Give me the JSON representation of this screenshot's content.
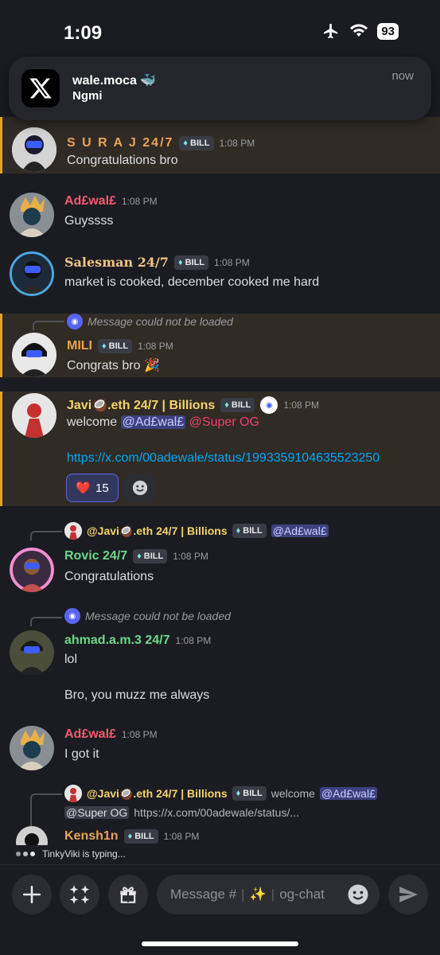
{
  "status": {
    "time": "1:09",
    "battery": "93"
  },
  "notification": {
    "title": "wale.moca 🐳",
    "body": "Ngmi",
    "time": "now"
  },
  "badge_label": "BILL",
  "messages": {
    "m1": {
      "name": "S U R A J  24/7",
      "time": "1:08 PM",
      "text": "Congratulations bro",
      "name_color": "#e8a35a"
    },
    "m2": {
      "name": "Ad£wal£",
      "time": "1:08 PM",
      "text": "Guyssss",
      "name_color": "#f25a6f"
    },
    "m3": {
      "name": "Salesman 24/7",
      "time": "1:08 PM",
      "text": "market is cooked, december cooked me hard",
      "name_color": "#f0c585"
    },
    "m4": {
      "reply": "Message could not be loaded",
      "name": "MILI",
      "time": "1:08 PM",
      "text": "Congrats bro 🎉",
      "name_color": "#f0a24a"
    },
    "m5": {
      "name": "Javi🥥.eth 24/7 | Billions",
      "time": "1:08 PM",
      "text_prefix": "welcome ",
      "mention1": "@Ad£wal£",
      "mention2": "@Super OG",
      "link": "https://x.com/00adewale/status/1993359104635523250",
      "reaction_emoji": "❤️",
      "reaction_count": "15",
      "name_color": "#f5d36c"
    },
    "m6": {
      "reply_name": "@Javi🥥.eth 24/7 | Billions",
      "reply_mention": "@Ad£wal£",
      "name": "Rovic 24/7",
      "time": "1:08 PM",
      "text": "Congratulations",
      "name_color": "#6bd88a"
    },
    "m7": {
      "reply": "Message could not be loaded",
      "name": "ahmad.a.m.3 24/7",
      "time": "1:08 PM",
      "text1": "lol",
      "text2": "Bro, you muzz me always",
      "name_color": "#6bd88a"
    },
    "m8": {
      "name": "Ad£wal£",
      "time": "1:08 PM",
      "text": "I got it",
      "name_color": "#f25a6f"
    },
    "m9": {
      "reply_name": "@Javi🥥.eth 24/7 | Billions",
      "reply_text": "welcome",
      "reply_mention1": "@Ad£wal£",
      "reply_mention2": "@Super OG",
      "reply_link": "https://x.com/00adewale/status/...",
      "name": "Kensh1n",
      "time": "1:08 PM",
      "name_color": "#e8a35a"
    }
  },
  "typing": "TinkyViki is typing...",
  "composer": {
    "placeholder_prefix": "Message #",
    "sparkle": "✨",
    "channel": "og-chat"
  }
}
